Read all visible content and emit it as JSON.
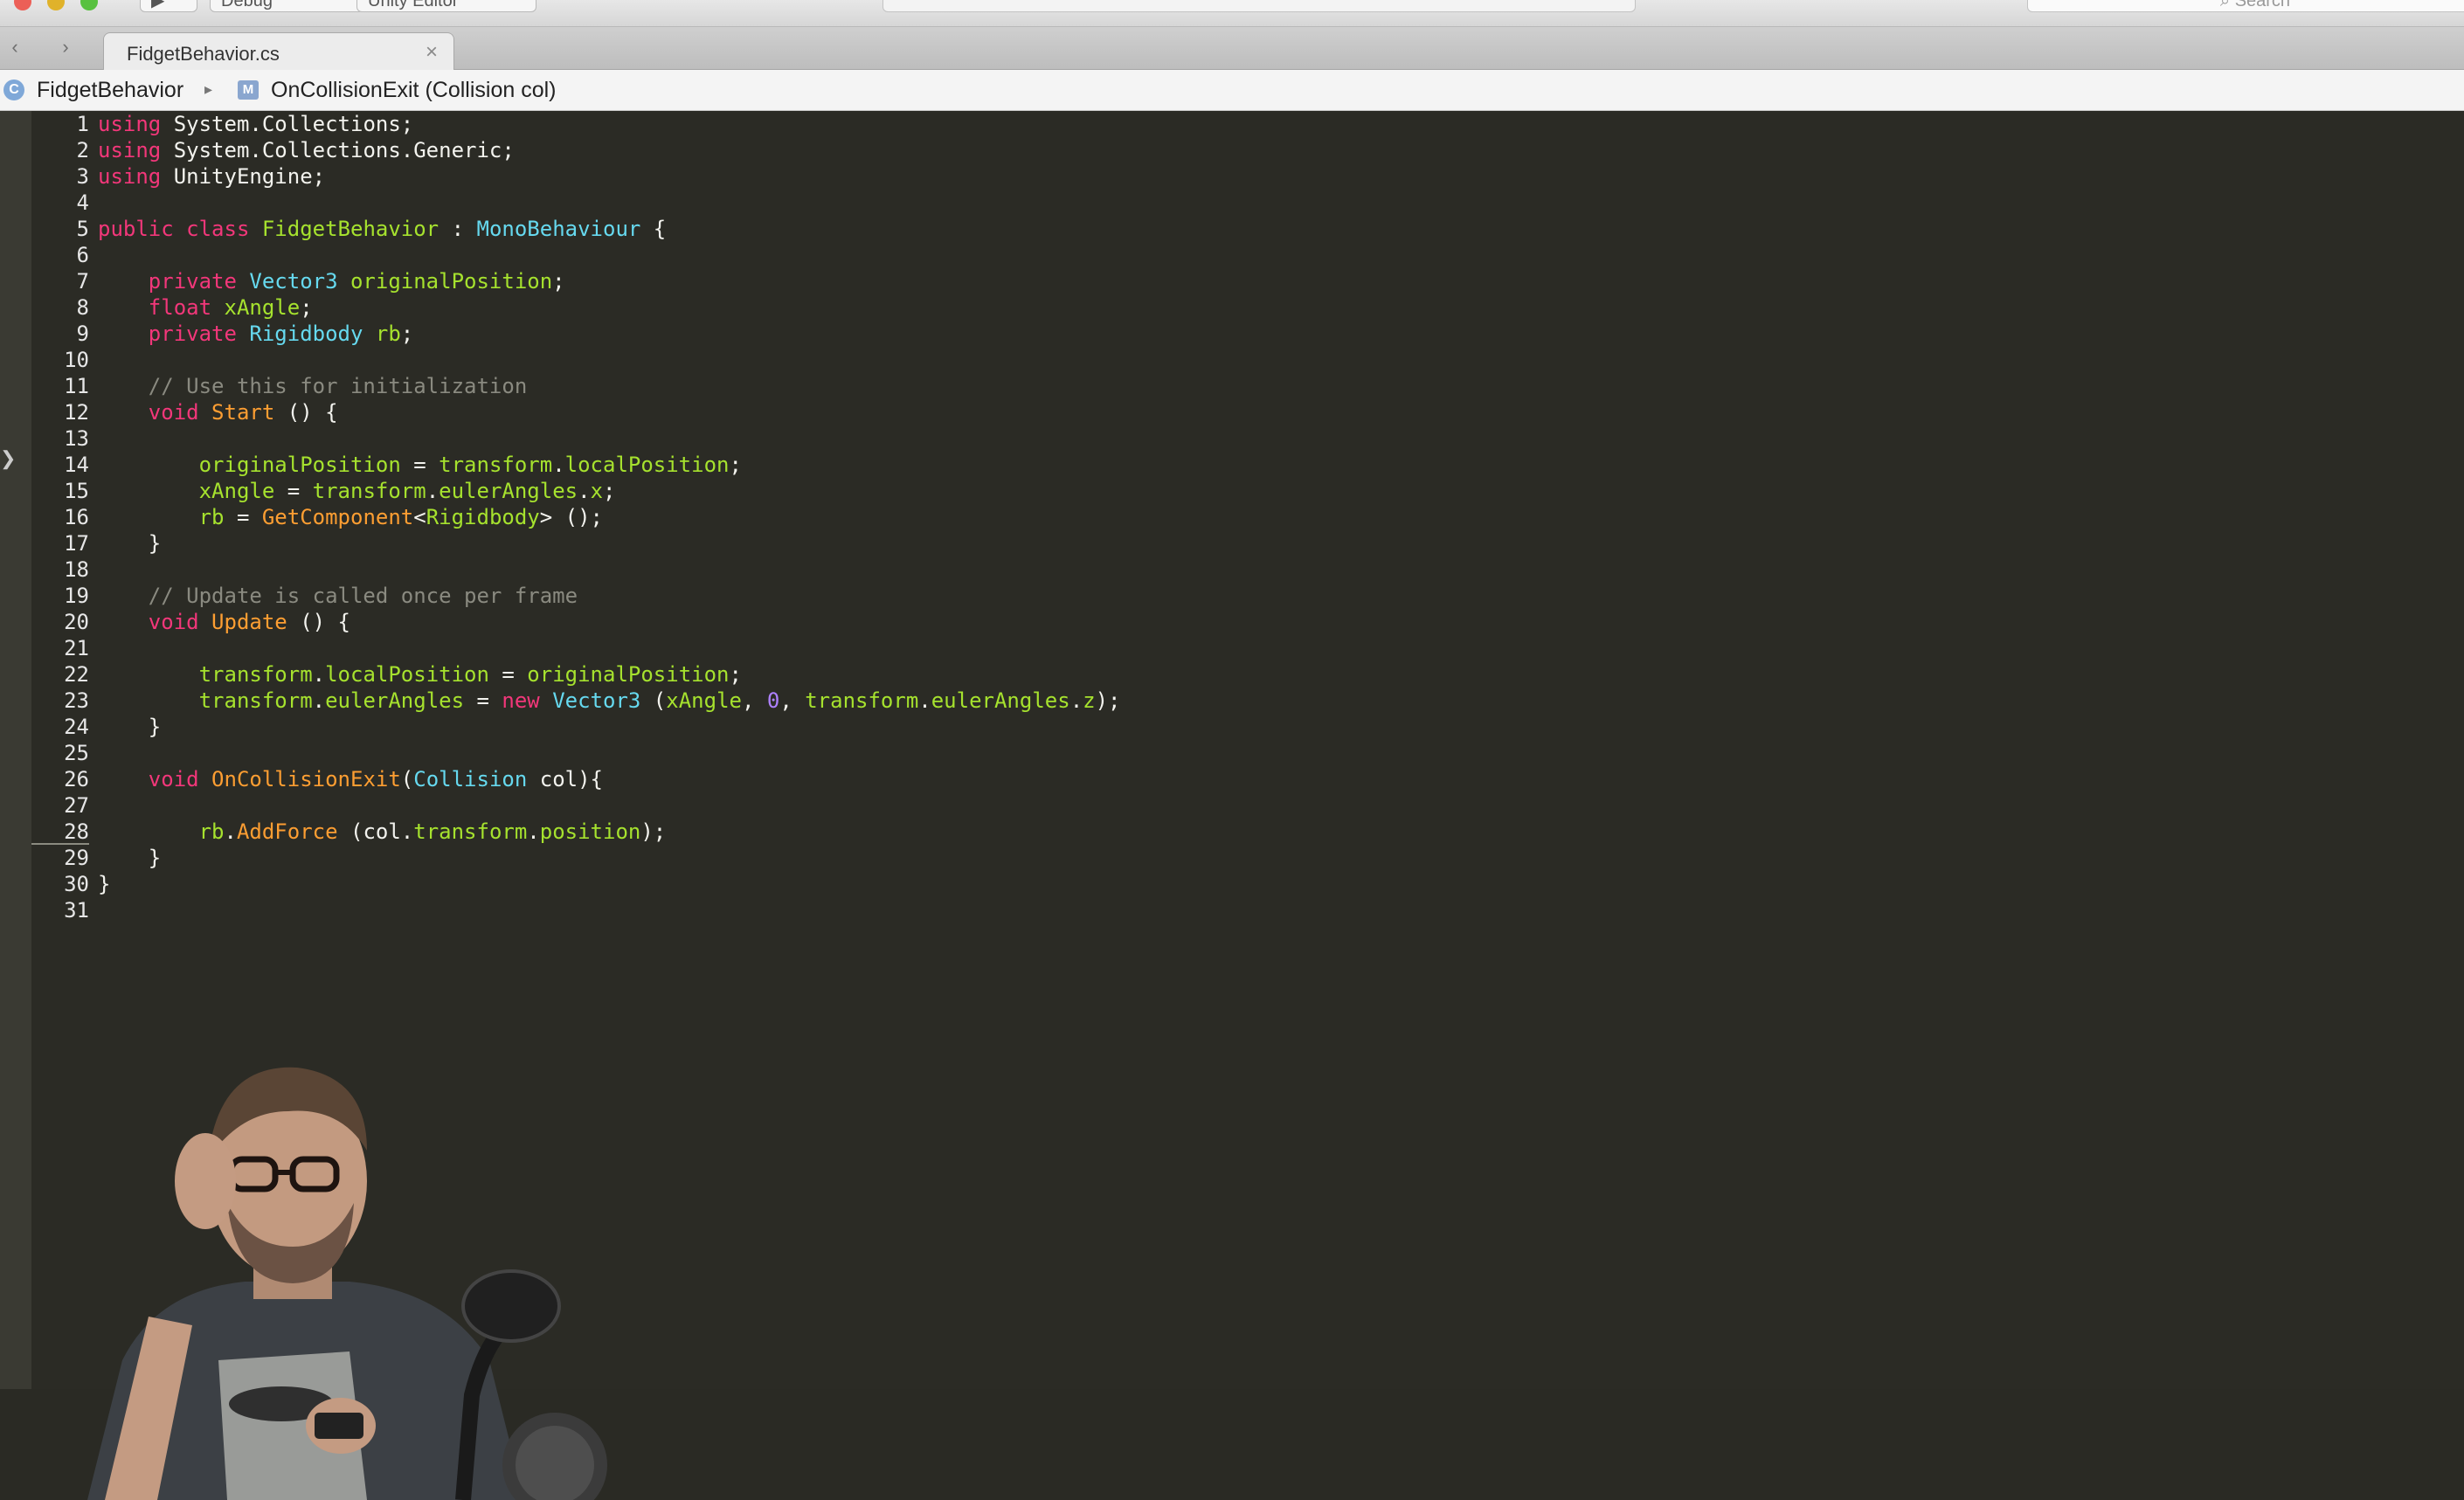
{
  "titlebar": {
    "buttons": [
      "Debug",
      "Unity Editor"
    ],
    "search_placeholder": "Search"
  },
  "tabbar": {
    "back_icon": "chevron-left-icon",
    "forward_icon": "chevron-right-icon",
    "active_tab": "FidgetBehavior.cs",
    "close_glyph": "×"
  },
  "breadcrumb": {
    "class_icon": "C",
    "class_name": "FidgetBehavior",
    "separator": "▸",
    "method_icon": "M",
    "method_name": "OnCollisionExit (Collision col)"
  },
  "colors": {
    "background": "#2b2b25",
    "keyword": "#f2377a",
    "type": "#66d9ef",
    "function": "#fd9e32",
    "identifier": "#a6e22e",
    "comment": "#8a8a80",
    "number": "#ae81ff",
    "plain": "#f3f3ee"
  },
  "editor": {
    "lines": [
      [
        [
          "kw",
          "using"
        ],
        [
          "src",
          " System.Collections;"
        ]
      ],
      [
        [
          "kw",
          "using"
        ],
        [
          "src",
          " System.Collections.Generic;"
        ]
      ],
      [
        [
          "kw",
          "using"
        ],
        [
          "src",
          " UnityEngine;"
        ]
      ],
      [],
      [
        [
          "kw",
          "public class "
        ],
        [
          "id",
          "FidgetBehavior"
        ],
        [
          "src",
          " : "
        ],
        [
          "ty",
          "MonoBehaviour"
        ],
        [
          "src",
          " {"
        ]
      ],
      [],
      [
        [
          "src",
          "    "
        ],
        [
          "kw",
          "private "
        ],
        [
          "ty",
          "Vector3 "
        ],
        [
          "id",
          "originalPosition"
        ],
        [
          "src",
          ";"
        ]
      ],
      [
        [
          "src",
          "    "
        ],
        [
          "kw",
          "float "
        ],
        [
          "id",
          "xAngle"
        ],
        [
          "src",
          ";"
        ]
      ],
      [
        [
          "src",
          "    "
        ],
        [
          "kw",
          "private "
        ],
        [
          "ty",
          "Rigidbody "
        ],
        [
          "id",
          "rb"
        ],
        [
          "src",
          ";"
        ]
      ],
      [],
      [
        [
          "src",
          "    "
        ],
        [
          "cm",
          "// Use this for initialization"
        ]
      ],
      [
        [
          "src",
          "    "
        ],
        [
          "kw",
          "void "
        ],
        [
          "fn",
          "Start"
        ],
        [
          "src",
          " () {"
        ]
      ],
      [],
      [
        [
          "src",
          "        "
        ],
        [
          "id",
          "originalPosition"
        ],
        [
          "src",
          " = "
        ],
        [
          "id",
          "transform"
        ],
        [
          "src",
          "."
        ],
        [
          "id",
          "localPosition"
        ],
        [
          "src",
          ";"
        ]
      ],
      [
        [
          "src",
          "        "
        ],
        [
          "id",
          "xAngle"
        ],
        [
          "src",
          " = "
        ],
        [
          "id",
          "transform"
        ],
        [
          "src",
          "."
        ],
        [
          "id",
          "eulerAngles"
        ],
        [
          "src",
          "."
        ],
        [
          "id",
          "x"
        ],
        [
          "src",
          ";"
        ]
      ],
      [
        [
          "src",
          "        "
        ],
        [
          "id",
          "rb"
        ],
        [
          "src",
          " = "
        ],
        [
          "fn",
          "GetComponent"
        ],
        [
          "src",
          "<"
        ],
        [
          "id",
          "Rigidbody"
        ],
        [
          "src",
          "> ();"
        ]
      ],
      [
        [
          "src",
          "    }"
        ]
      ],
      [],
      [
        [
          "src",
          "    "
        ],
        [
          "cm",
          "// Update is called once per frame"
        ]
      ],
      [
        [
          "src",
          "    "
        ],
        [
          "kw",
          "void "
        ],
        [
          "fn",
          "Update"
        ],
        [
          "src",
          " () {"
        ]
      ],
      [],
      [
        [
          "src",
          "        "
        ],
        [
          "id",
          "transform"
        ],
        [
          "src",
          "."
        ],
        [
          "id",
          "localPosition"
        ],
        [
          "src",
          " = "
        ],
        [
          "id",
          "originalPosition"
        ],
        [
          "src",
          ";"
        ]
      ],
      [
        [
          "src",
          "        "
        ],
        [
          "id",
          "transform"
        ],
        [
          "src",
          "."
        ],
        [
          "id",
          "eulerAngles"
        ],
        [
          "src",
          " = "
        ],
        [
          "kw",
          "new "
        ],
        [
          "ty",
          "Vector3"
        ],
        [
          "src",
          " ("
        ],
        [
          "id",
          "xAngle"
        ],
        [
          "src",
          ", "
        ],
        [
          "nm",
          "0"
        ],
        [
          "src",
          ", "
        ],
        [
          "id",
          "transform"
        ],
        [
          "src",
          "."
        ],
        [
          "id",
          "eulerAngles"
        ],
        [
          "src",
          "."
        ],
        [
          "id",
          "z"
        ],
        [
          "src",
          ");"
        ]
      ],
      [
        [
          "src",
          "    }"
        ]
      ],
      [],
      [
        [
          "src",
          "    "
        ],
        [
          "kw",
          "void "
        ],
        [
          "fn",
          "OnCollisionExit"
        ],
        [
          "src",
          "("
        ],
        [
          "ty",
          "Collision"
        ],
        [
          "src",
          " col){"
        ]
      ],
      [],
      [
        [
          "src",
          "        "
        ],
        [
          "id",
          "rb"
        ],
        [
          "src",
          "."
        ],
        [
          "fn",
          "AddForce"
        ],
        [
          "src",
          " (col."
        ],
        [
          "id",
          "transform"
        ],
        [
          "src",
          "."
        ],
        [
          "id",
          "position"
        ],
        [
          "src",
          ");"
        ]
      ],
      [
        [
          "src",
          "    }"
        ]
      ],
      [
        [
          "src",
          "}"
        ]
      ],
      []
    ]
  }
}
